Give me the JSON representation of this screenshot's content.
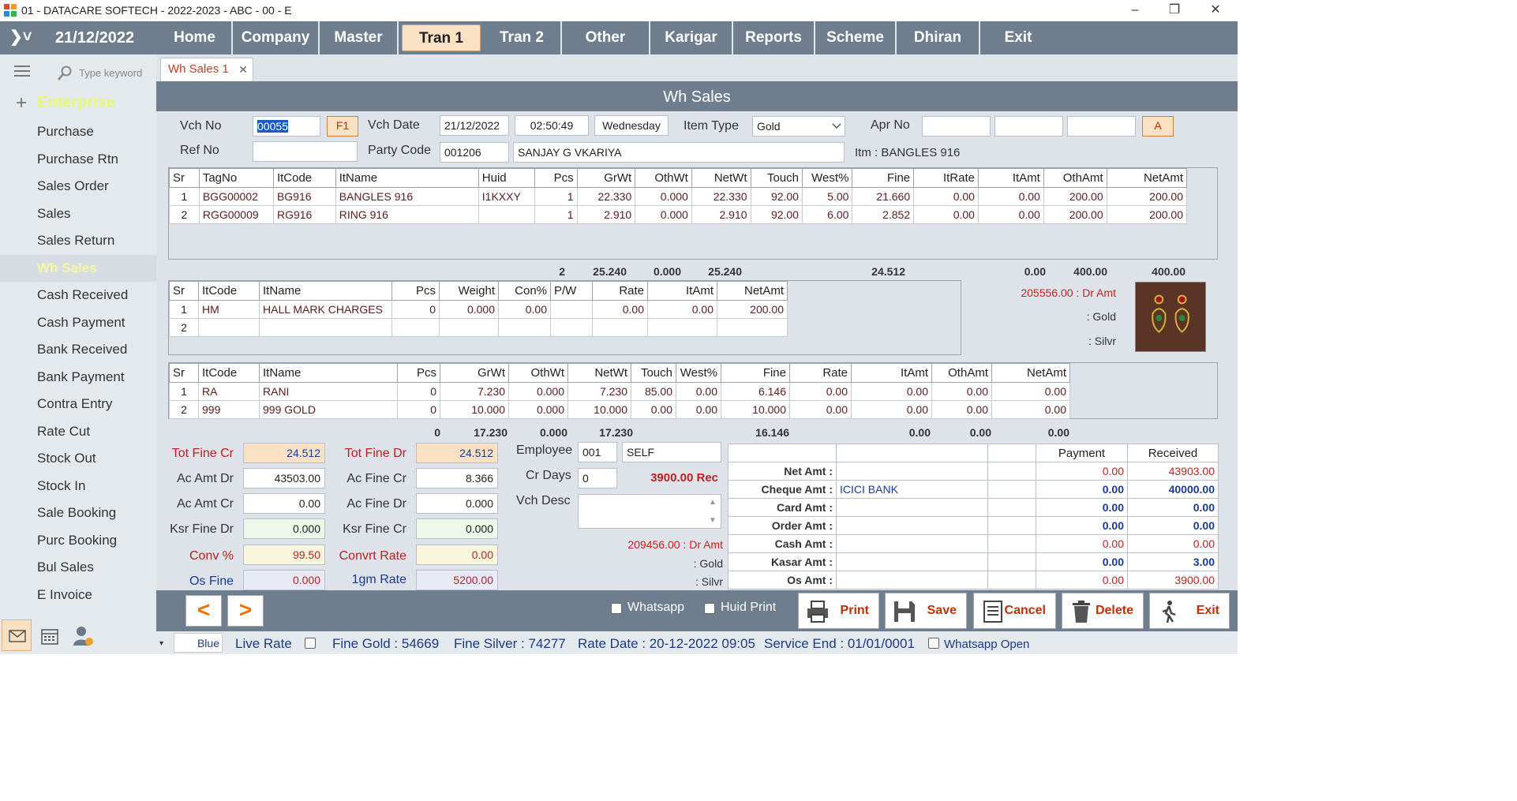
{
  "window": {
    "title": "01 - DATACARE SOFTECH - 2022-2023 - ABC - 00 - E",
    "minimize": "–",
    "restore": "❐",
    "close": "✕"
  },
  "menu": {
    "chevron": "❯˅",
    "date": "21/12/2022",
    "items": [
      "Home",
      "Company",
      "Master",
      "Tran 1",
      "Tran 2",
      "Other",
      "Karigar",
      "Reports",
      "Scheme",
      "Dhiran",
      "Exit"
    ],
    "active": "Tran 1"
  },
  "sidebar": {
    "search_placeholder": "Type keyword",
    "section": "Enterprise",
    "items": [
      "Purchase",
      "Purchase Rtn",
      "Sales Order",
      "Sales",
      "Sales Return",
      "Wh Sales",
      "Cash Received",
      "Cash Payment",
      "Bank Received",
      "Bank Payment",
      "Contra Entry",
      "Rate Cut",
      "Stock Out",
      "Stock In",
      "Sale Booking",
      "Purc Booking",
      "Bul Sales",
      "E Invoice"
    ],
    "active": "Wh Sales"
  },
  "tab": {
    "label": "Wh Sales 1",
    "close": "✕"
  },
  "form": {
    "title": "Wh Sales",
    "vch_no_label": "Vch No",
    "vch_no": "00055",
    "f1": "F1",
    "vch_date_label": "Vch Date",
    "vch_date": "21/12/2022",
    "time": "02:50:49",
    "day": "Wednesday",
    "item_type_label": "Item Type",
    "item_type": "Gold",
    "apr_no_label": "Apr No",
    "apr_btn": "A",
    "ref_no_label": "Ref No",
    "ref_no": "",
    "party_code_label": "Party Code",
    "party_code": "001206",
    "party_name": "SANJAY G VKARIYA",
    "itm_info": "Itm : BANGLES 916"
  },
  "grid1": {
    "headers": [
      "Sr",
      "TagNo",
      "ItCode",
      "ItName",
      "Huid",
      "Pcs",
      "GrWt",
      "OthWt",
      "NetWt",
      "Touch",
      "West%",
      "Fine",
      "ItRate",
      "ItAmt",
      "OthAmt",
      "NetAmt"
    ],
    "rows": [
      [
        "1",
        "BGG00002",
        "BG916",
        "BANGLES 916",
        "I1KXXY",
        "1",
        "22.330",
        "0.000",
        "22.330",
        "92.00",
        "5.00",
        "21.660",
        "0.00",
        "0.00",
        "200.00",
        "200.00"
      ],
      [
        "2",
        "RGG00009",
        "RG916",
        "RING 916",
        "",
        "1",
        "2.910",
        "0.000",
        "2.910",
        "92.00",
        "6.00",
        "2.852",
        "0.00",
        "0.00",
        "200.00",
        "200.00"
      ]
    ],
    "totals": {
      "pcs": "2",
      "grwt": "25.240",
      "othwt": "0.000",
      "netwt": "25.240",
      "fine": "24.512",
      "itamt": "0.00",
      "othamt": "400.00",
      "netamt": "400.00"
    }
  },
  "grid2": {
    "headers": [
      "Sr",
      "ItCode",
      "ItName",
      "Pcs",
      "Weight",
      "Con%",
      "P/W",
      "Rate",
      "ItAmt",
      "NetAmt"
    ],
    "rows": [
      [
        "1",
        "HM",
        "HALL MARK CHARGES",
        "0",
        "0.000",
        "0.00",
        "",
        "0.00",
        "0.00",
        "200.00"
      ],
      [
        "2",
        "",
        "",
        "",
        "",
        "",
        "",
        "",
        "",
        ""
      ]
    ]
  },
  "side_info": {
    "dr_amt": "205556.00 : Dr Amt",
    "gold": ": Gold",
    "silver": ": Silvr"
  },
  "grid3": {
    "headers": [
      "Sr",
      "ItCode",
      "ItName",
      "Pcs",
      "GrWt",
      "OthWt",
      "NetWt",
      "Touch",
      "West%",
      "Fine",
      "Rate",
      "ItAmt",
      "OthAmt",
      "NetAmt"
    ],
    "rows": [
      [
        "1",
        "RA",
        "RANI",
        "0",
        "7.230",
        "0.000",
        "7.230",
        "85.00",
        "0.00",
        "6.146",
        "0.00",
        "0.00",
        "0.00",
        "0.00"
      ],
      [
        "2",
        "999",
        "999 GOLD",
        "0",
        "10.000",
        "0.000",
        "10.000",
        "0.00",
        "0.00",
        "10.000",
        "0.00",
        "0.00",
        "0.00",
        "0.00"
      ]
    ],
    "totals": {
      "pcs": "0",
      "grwt": "17.230",
      "othwt": "0.000",
      "netwt": "17.230",
      "fine": "16.146",
      "itamt": "0.00",
      "othamt": "0.00",
      "netamt": "0.00"
    }
  },
  "summary": {
    "tot_fine_cr_label": "Tot Fine Cr",
    "tot_fine_cr": "24.512",
    "tot_fine_dr_label": "Tot Fine Dr",
    "tot_fine_dr": "24.512",
    "ac_amt_dr_label": "Ac Amt Dr",
    "ac_amt_dr": "43503.00",
    "ac_fine_cr_label": "Ac Fine Cr",
    "ac_fine_cr": "8.366",
    "ac_amt_cr_label": "Ac Amt Cr",
    "ac_amt_cr": "0.00",
    "ac_fine_dr_label": "Ac Fine Dr",
    "ac_fine_dr": "0.000",
    "ksr_fine_dr_label": "Ksr Fine Dr",
    "ksr_fine_dr": "0.000",
    "ksr_fine_cr_label": "Ksr Fine Cr",
    "ksr_fine_cr": "0.000",
    "conv_label": "Conv %",
    "conv": "99.50",
    "convrt_rate_label": "Convrt Rate",
    "convrt_rate": "0.00",
    "os_fine_label": "Os Fine",
    "os_fine": "0.000",
    "gm_rate_label": "1gm Rate",
    "gm_rate": "5200.00",
    "employee_label": "Employee",
    "employee_code": "001",
    "employee_name": "SELF",
    "cr_days_label": "Cr Days",
    "cr_days": "0",
    "rec_amt": "3900.00  Rec",
    "vch_desc_label": "Vch Desc",
    "dr_amt2": "209456.00 : Dr Amt",
    "gold2": ": Gold",
    "silver2": ": Silvr"
  },
  "payment": {
    "headers": [
      "",
      "",
      "",
      "Payment",
      "Received"
    ],
    "rows": [
      {
        "label": "Net Amt :",
        "info": "",
        "payment": "0.00",
        "received": "43903.00",
        "style": "v"
      },
      {
        "label": "Cheque Amt :",
        "info": "ICICI BANK",
        "payment": "0.00",
        "received": "40000.00",
        "style": "vb"
      },
      {
        "label": "Card Amt :",
        "info": "",
        "payment": "0.00",
        "received": "0.00",
        "style": "vb"
      },
      {
        "label": "Order Amt :",
        "info": "",
        "payment": "0.00",
        "received": "0.00",
        "style": "vb"
      },
      {
        "label": "Cash Amt :",
        "info": "",
        "payment": "0.00",
        "received": "0.00",
        "style": "v"
      },
      {
        "label": "Kasar Amt :",
        "info": "",
        "payment": "0.00",
        "received": "3.00",
        "style": "vb"
      },
      {
        "label": "Os Amt :",
        "info": "",
        "payment": "0.00",
        "received": "3900.00",
        "style": "v"
      }
    ]
  },
  "toolbar": {
    "prev": "<",
    "next": ">",
    "whatsapp": "Whatsapp",
    "huid_print": "Huid Print",
    "print": "Print",
    "save": "Save",
    "cancel": "Cancel",
    "delete": "Delete",
    "exit": "Exit"
  },
  "status": {
    "theme": "Blue",
    "live_rate": "Live Rate",
    "fine_gold": "Fine Gold : 54669",
    "fine_silver": "Fine Silver : 74277",
    "rate_date": "Rate Date : 20-12-2022 09:05",
    "service_end": "Service End :  01/01/0001",
    "whatsapp_open": "Whatsapp Open"
  }
}
